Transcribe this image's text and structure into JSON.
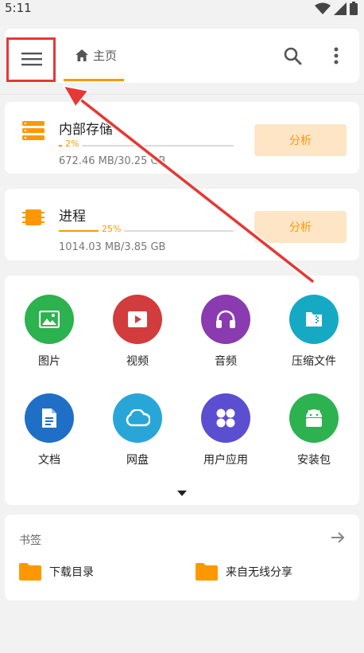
{
  "status_bar": {
    "time": "5:11"
  },
  "header": {
    "home_tab_label": "主页"
  },
  "storage": [
    {
      "title": "内部存储",
      "percent_label": "2%",
      "percent": 2,
      "size": "672.46 MB/30.25 GB",
      "button": "分析"
    },
    {
      "title": "进程",
      "percent_label": "25%",
      "percent": 25,
      "size": "1014.03 MB/3.85 GB",
      "button": "分析"
    }
  ],
  "categories": [
    {
      "label": "图片",
      "icon": "image-icon",
      "color": "#2cb24f"
    },
    {
      "label": "视频",
      "icon": "video-icon",
      "color": "#d23c3c"
    },
    {
      "label": "音频",
      "icon": "headphones-icon",
      "color": "#8a3bb0"
    },
    {
      "label": "压缩文件",
      "icon": "zip-icon",
      "color": "#16a9c4"
    },
    {
      "label": "文档",
      "icon": "document-icon",
      "color": "#1f6fc7"
    },
    {
      "label": "网盘",
      "icon": "cloud-icon",
      "color": "#28a6d8"
    },
    {
      "label": "用户应用",
      "icon": "apps-icon",
      "color": "#5b4ed1"
    },
    {
      "label": "安装包",
      "icon": "android-icon",
      "color": "#2cb24f"
    }
  ],
  "bookmarks": {
    "title": "书签",
    "items": [
      {
        "label": "下载目录",
        "icon": "folder-icon"
      },
      {
        "label": "来自无线分享",
        "icon": "folder-icon"
      }
    ]
  },
  "colors": {
    "accent": "#ff9800",
    "annotation": "#e53935"
  }
}
